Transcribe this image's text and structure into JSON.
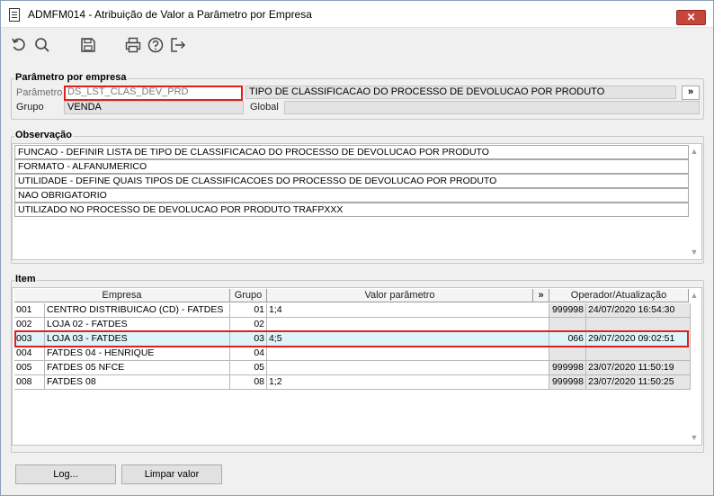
{
  "window": {
    "title": "ADMFM014 - Atribuição de Valor a Parâmetro por Empresa",
    "close_label": "✕"
  },
  "toolbar": {
    "buttons": [
      "refresh-icon",
      "search-icon",
      "save-icon",
      "print-icon",
      "help-icon",
      "exit-icon"
    ]
  },
  "parametro_empresa": {
    "title": "Parâmetro por empresa",
    "parametro_label": "Parâmetro",
    "parametro_value": "DS_LST_CLAS_DEV_PRD",
    "parametro_desc": "TIPO DE CLASSIFICACAO DO PROCESSO DE  DEVOLUCAO POR PRODUTO",
    "expand_label": "»",
    "grupo_label": "Grupo",
    "grupo_value": "VENDA",
    "global_label": "Global",
    "global_value": ""
  },
  "observacao": {
    "title": "Observação",
    "lines": [
      "FUNCAO -  DEFINIR LISTA DE TIPO DE CLASSIFICACAO DO PROCESSO DE  DEVOLUCAO POR PRODUTO",
      "FORMATO - ALFANUMERICO",
      "UTILIDADE - DEFINE QUAIS TIPOS DE CLASSIFICACOES DO PROCESSO DE DEVOLUCAO POR PRODUTO",
      "NAO OBRIGATORIO",
      "UTILIZADO NO PROCESSO DE DEVOLUCAO POR PRODUTO TRAFPXXX"
    ]
  },
  "item": {
    "title": "Item",
    "columns": {
      "empresa": "Empresa",
      "grupo": "Grupo",
      "valor": "Valor parâmetro",
      "expand": "»",
      "operador": "Operador/Atualização"
    },
    "rows": [
      {
        "code": "001",
        "empresa": "CENTRO DISTRIBUICAO (CD) - FATDES",
        "grupo": "01",
        "valor": "1;4",
        "operador": "999998",
        "atualizacao": "24/07/2020 16:54:30"
      },
      {
        "code": "002",
        "empresa": "LOJA 02 - FATDES",
        "grupo": "02",
        "valor": "",
        "operador": "",
        "atualizacao": ""
      },
      {
        "code": "003",
        "empresa": "LOJA 03 - FATDES",
        "grupo": "03",
        "valor": "4;5",
        "operador": "066",
        "atualizacao": "29/07/2020 09:02:51"
      },
      {
        "code": "004",
        "empresa": "FATDES 04 - HENRIQUE",
        "grupo": "04",
        "valor": "",
        "operador": "",
        "atualizacao": ""
      },
      {
        "code": "005",
        "empresa": "FATDES 05 NFCE",
        "grupo": "05",
        "valor": "",
        "operador": "999998",
        "atualizacao": "23/07/2020 11:50:19"
      },
      {
        "code": "008",
        "empresa": "FATDES 08",
        "grupo": "08",
        "valor": "1;2",
        "operador": "999998",
        "atualizacao": "23/07/2020 11:50:25"
      }
    ]
  },
  "buttons": {
    "log": "Log...",
    "limpar": "Limpar valor"
  },
  "colors": {
    "highlight_border": "#e0201c",
    "selected_row": "#dff3fa",
    "close_button": "#c7463c"
  }
}
